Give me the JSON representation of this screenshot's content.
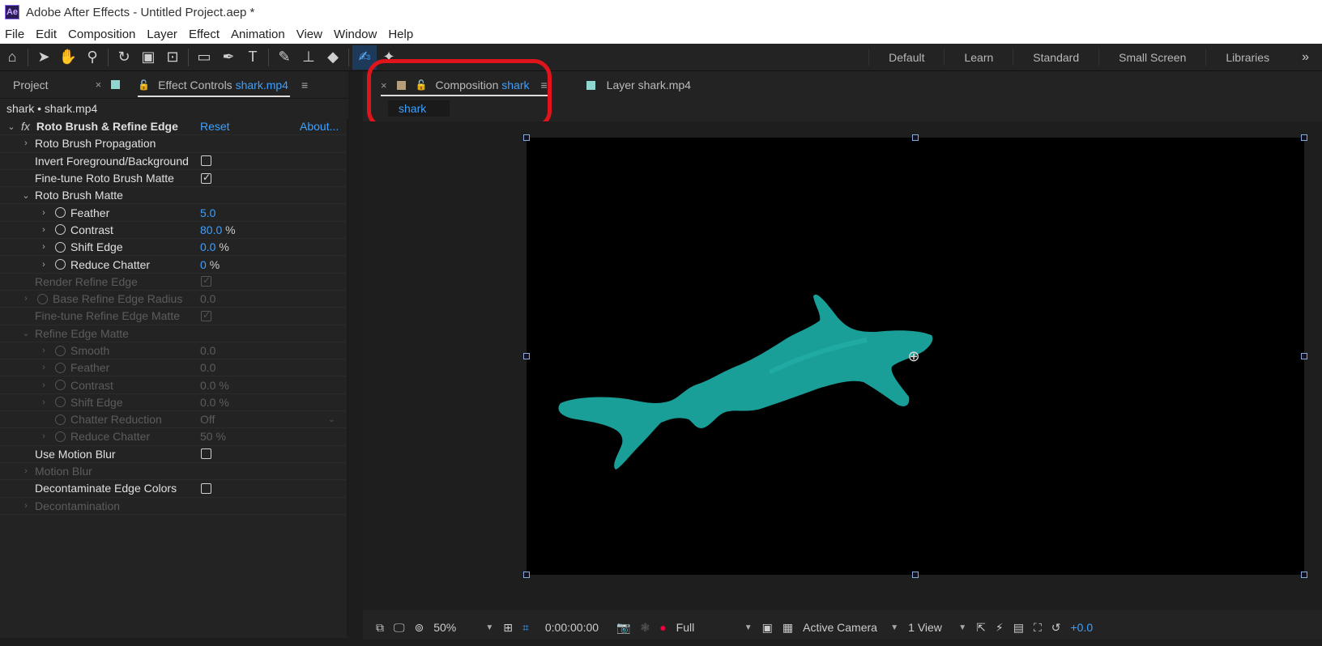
{
  "window": {
    "title": "Adobe After Effects - Untitled Project.aep *",
    "logo": "Ae"
  },
  "menu": [
    "File",
    "Edit",
    "Composition",
    "Layer",
    "Effect",
    "Animation",
    "View",
    "Window",
    "Help"
  ],
  "workspaces": [
    "Default",
    "Learn",
    "Standard",
    "Small Screen",
    "Libraries"
  ],
  "left_panel": {
    "project_tab": "Project",
    "effect_controls_label": "Effect Controls",
    "effect_controls_target": "shark.mp4",
    "layer_title": "shark • shark.mp4",
    "effect": {
      "fx": "fx",
      "name": "Roto Brush & Refine Edge",
      "reset": "Reset",
      "about": "About..."
    },
    "rows": [
      {
        "label": "Roto Brush Propagation",
        "tw": "›"
      },
      {
        "label": "Invert Foreground/Background",
        "checkbox": false
      },
      {
        "label": "Fine-tune Roto Brush Matte",
        "checkbox": true
      },
      {
        "label": "Roto Brush Matte",
        "tw": "⌄"
      },
      {
        "label": "Feather",
        "value": "5.0",
        "unit": ""
      },
      {
        "label": "Contrast",
        "value": "80.0",
        "unit": "%"
      },
      {
        "label": "Shift Edge",
        "value": "0.0",
        "unit": "%"
      },
      {
        "label": "Reduce Chatter",
        "value": "0",
        "unit": "%"
      },
      {
        "label": "Render Refine Edge",
        "checkbox": true
      },
      {
        "label": "Base Refine Edge Radius",
        "value": "0.0"
      },
      {
        "label": "Fine-tune Refine Edge Matte",
        "checkbox": true
      },
      {
        "label": "Refine Edge Matte",
        "tw": "⌄"
      },
      {
        "label": "Smooth",
        "value": "0.0"
      },
      {
        "label": "Feather",
        "value": "0.0"
      },
      {
        "label": "Contrast",
        "value": "0.0 %"
      },
      {
        "label": "Shift Edge",
        "value": "0.0 %"
      },
      {
        "label": "Chatter Reduction",
        "value": "Off"
      },
      {
        "label": "Reduce Chatter",
        "value": "50 %"
      },
      {
        "label": "Use Motion Blur",
        "checkbox": false
      },
      {
        "label": "Motion Blur",
        "tw": "›"
      },
      {
        "label": "Decontaminate Edge Colors",
        "checkbox": false
      },
      {
        "label": "Decontamination",
        "tw": "›"
      }
    ]
  },
  "comp_panel": {
    "comp_label": "Composition",
    "comp_name": "shark",
    "layer_tab": "Layer  shark.mp4",
    "flow_tab": "shark"
  },
  "viewer_bar": {
    "zoom": "50%",
    "timecode": "0:00:00:00",
    "resolution": "Full",
    "camera": "Active Camera",
    "views": "1 View",
    "exposure": "+0.0"
  },
  "colors": {
    "accent": "#3ea0ff",
    "highlight": "#e0141b",
    "shark": "#1a9e98"
  }
}
